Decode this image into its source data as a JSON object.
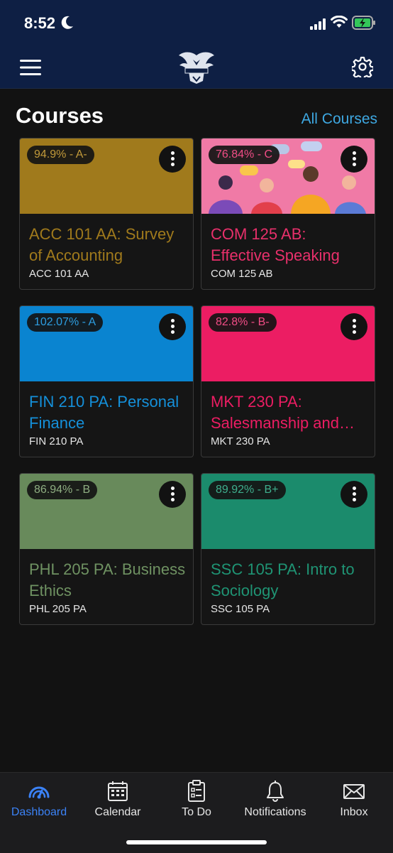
{
  "status_bar": {
    "time": "8:52"
  },
  "header": {
    "title": "Courses",
    "all_courses_link": "All Courses"
  },
  "courses": [
    {
      "grade": "94.9% - A-",
      "title": "ACC 101 AA: Survey of Accounting",
      "code": "ACC 101 AA",
      "color": "#a07a1c"
    },
    {
      "grade": "76.84% - C",
      "title": "COM 125 AB: Effective Speaking",
      "code": "COM 125 AB",
      "color": "#e8306b"
    },
    {
      "grade": "102.07% - A",
      "title": "FIN 210 PA: Personal Finance",
      "code": "FIN 210 PA",
      "color": "#0a84d0"
    },
    {
      "grade": "82.8% - B-",
      "title": "MKT 230 PA: Salesmanship and…",
      "code": "MKT 230 PA",
      "color": "#ec1d63"
    },
    {
      "grade": "86.94% - B",
      "title": "PHL 205 PA: Business Ethics",
      "code": "PHL 205 PA",
      "color": "#688a5b"
    },
    {
      "grade": "89.92% - B+",
      "title": "SSC 105 PA: Intro to Sociology",
      "code": "SSC 105 PA",
      "color": "#1b8b6c"
    }
  ],
  "tabs": [
    {
      "label": "Dashboard",
      "icon": "dashboard-icon",
      "active": true
    },
    {
      "label": "Calendar",
      "icon": "calendar-icon"
    },
    {
      "label": "To Do",
      "icon": "todo-icon"
    },
    {
      "label": "Notifications",
      "icon": "bell-icon"
    },
    {
      "label": "Inbox",
      "icon": "inbox-icon"
    }
  ],
  "colors": {
    "nav_bg": "#0e1f44",
    "link": "#3ea8e2",
    "active_tab": "#3b82f6"
  }
}
